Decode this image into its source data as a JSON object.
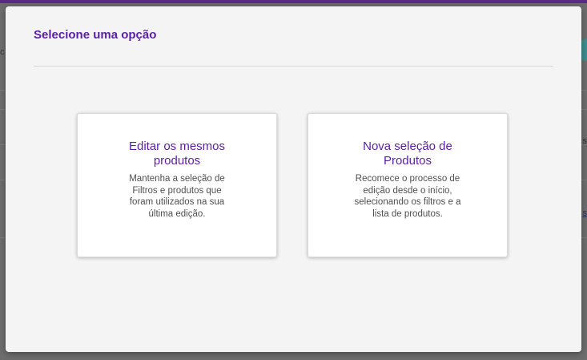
{
  "background": {
    "left_fragment": "c",
    "right_fragment": "s",
    "right_link_fragment": "s"
  },
  "modal": {
    "title": "Selecione uma opção",
    "options": [
      {
        "title": "Editar os mesmos produtos",
        "description": "Mantenha a seleção de Filtros e produtos que foram utilizados na sua última edição."
      },
      {
        "title": "Nova seleção de Produtos",
        "description": "Recomece o processo de edição desde o início, selecionando os filtros e a lista de produtos."
      }
    ]
  },
  "colors": {
    "accent": "#5a1eaa",
    "modal_bg": "#f4f4f4",
    "overlay": "#5f5f5f"
  }
}
